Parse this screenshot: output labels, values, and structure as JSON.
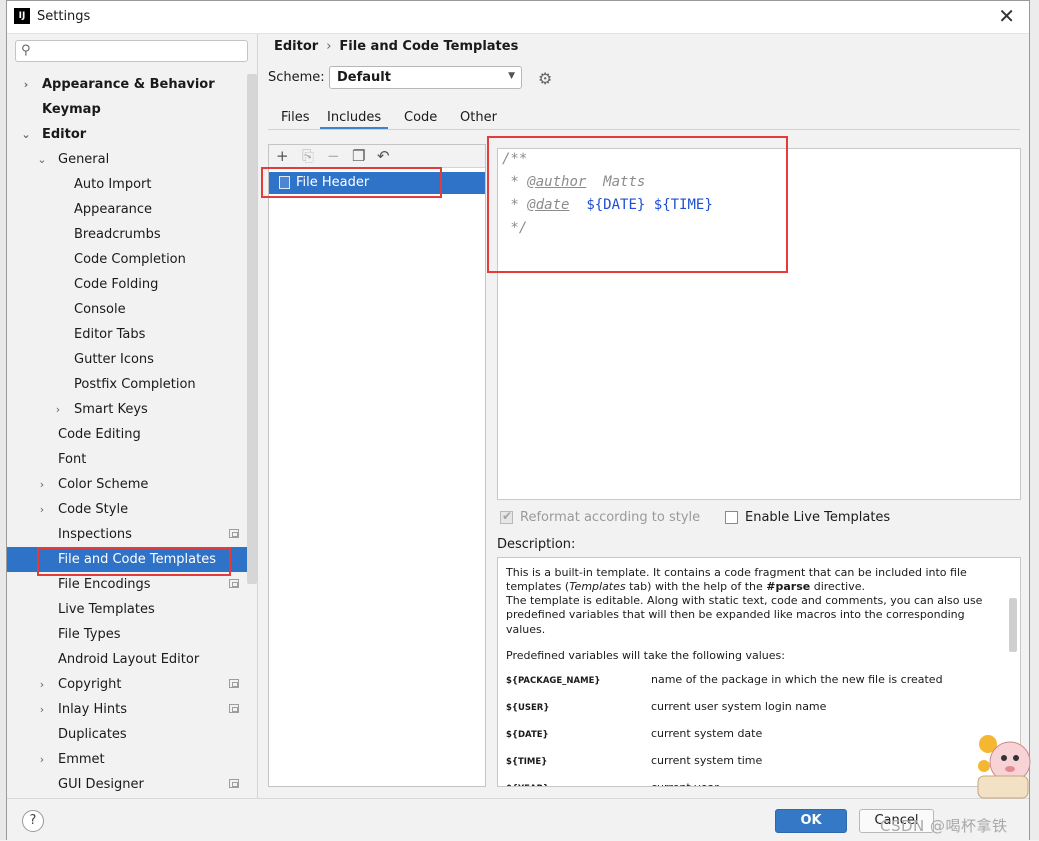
{
  "window": {
    "title": "Settings",
    "app_icon": "IJ"
  },
  "search": {
    "placeholder": ""
  },
  "tree": [
    {
      "label": "Appearance & Behavior",
      "level": 0,
      "arrow": "›",
      "bold": true
    },
    {
      "label": "Keymap",
      "level": 0,
      "arrow": "",
      "bold": true
    },
    {
      "label": "Editor",
      "level": 0,
      "arrow": "⌄",
      "bold": true
    },
    {
      "label": "General",
      "level": 1,
      "arrow": "⌄"
    },
    {
      "label": "Auto Import",
      "level": 2,
      "arrow": ""
    },
    {
      "label": "Appearance",
      "level": 2,
      "arrow": ""
    },
    {
      "label": "Breadcrumbs",
      "level": 2,
      "arrow": ""
    },
    {
      "label": "Code Completion",
      "level": 2,
      "arrow": ""
    },
    {
      "label": "Code Folding",
      "level": 2,
      "arrow": ""
    },
    {
      "label": "Console",
      "level": 2,
      "arrow": ""
    },
    {
      "label": "Editor Tabs",
      "level": 2,
      "arrow": ""
    },
    {
      "label": "Gutter Icons",
      "level": 2,
      "arrow": ""
    },
    {
      "label": "Postfix Completion",
      "level": 2,
      "arrow": ""
    },
    {
      "label": "Smart Keys",
      "level": 2,
      "arrow": "›"
    },
    {
      "label": "Code Editing",
      "level": 1,
      "arrow": ""
    },
    {
      "label": "Font",
      "level": 1,
      "arrow": ""
    },
    {
      "label": "Color Scheme",
      "level": 1,
      "arrow": "›"
    },
    {
      "label": "Code Style",
      "level": 1,
      "arrow": "›"
    },
    {
      "label": "Inspections",
      "level": 1,
      "arrow": "",
      "project_icon": true
    },
    {
      "label": "File and Code Templates",
      "level": 1,
      "arrow": "",
      "selected": true
    },
    {
      "label": "File Encodings",
      "level": 1,
      "arrow": "",
      "project_icon": true
    },
    {
      "label": "Live Templates",
      "level": 1,
      "arrow": ""
    },
    {
      "label": "File Types",
      "level": 1,
      "arrow": ""
    },
    {
      "label": "Android Layout Editor",
      "level": 1,
      "arrow": ""
    },
    {
      "label": "Copyright",
      "level": 1,
      "arrow": "›",
      "project_icon": true
    },
    {
      "label": "Inlay Hints",
      "level": 1,
      "arrow": "›",
      "project_icon": true
    },
    {
      "label": "Duplicates",
      "level": 1,
      "arrow": ""
    },
    {
      "label": "Emmet",
      "level": 1,
      "arrow": "›"
    },
    {
      "label": "GUI Designer",
      "level": 1,
      "arrow": "",
      "project_icon": true
    }
  ],
  "breadcrumb": {
    "parent": "Editor",
    "separator": "›",
    "current": "File and Code Templates"
  },
  "scheme": {
    "label": "Scheme:",
    "value": "Default"
  },
  "tabs": [
    "Files",
    "Includes",
    "Code",
    "Other"
  ],
  "active_tab": "Includes",
  "toolbar_icons": [
    "plus-icon",
    "copy-add-icon",
    "minus-icon",
    "copy-icon",
    "reset-icon"
  ],
  "templates": [
    {
      "name": "File Header",
      "selected": true
    }
  ],
  "editor": {
    "line1": "/**",
    "line2_prefix": " * ",
    "line2_tag": "@author",
    "line2_rest": "  Matts",
    "line3_prefix": " * ",
    "line3_tag": "@date",
    "line3_sp": "  ",
    "line3_var1": "${DATE}",
    "line3_sp2": " ",
    "line3_var2": "${TIME}",
    "line4": " */"
  },
  "options": {
    "reformat": {
      "label": "Reformat according to style",
      "checked": true,
      "disabled": true
    },
    "live_templates": {
      "label": "Enable Live Templates",
      "checked": false
    }
  },
  "description": {
    "label": "Description:",
    "p1_a": "This is a built-in template. It contains a code fragment that can be included into file templates (",
    "p1_italic": "Templates",
    "p1_b": " tab) with the help of the ",
    "p1_bold": "#parse",
    "p1_c": " directive.",
    "p2": "The template is editable. Along with static text, code and comments, you can also use predefined variables that will then be expanded like macros into the corresponding values.",
    "p3": "Predefined variables will take the following values:",
    "variables": [
      {
        "name": "${PACKAGE_NAME}",
        "desc": "name of the package in which the new file is created"
      },
      {
        "name": "${USER}",
        "desc": "current user system login name"
      },
      {
        "name": "${DATE}",
        "desc": "current system date"
      },
      {
        "name": "${TIME}",
        "desc": "current system time"
      },
      {
        "name": "${YEAR}",
        "desc": "current year"
      }
    ]
  },
  "footer": {
    "ok": "OK",
    "cancel": "Cancel",
    "help": "?"
  },
  "watermark": "CSDN @喝杯拿铁",
  "colors": {
    "selection": "#2f73c9",
    "highlight_box": "#e53b3b",
    "ok_button": "#3478c6"
  }
}
